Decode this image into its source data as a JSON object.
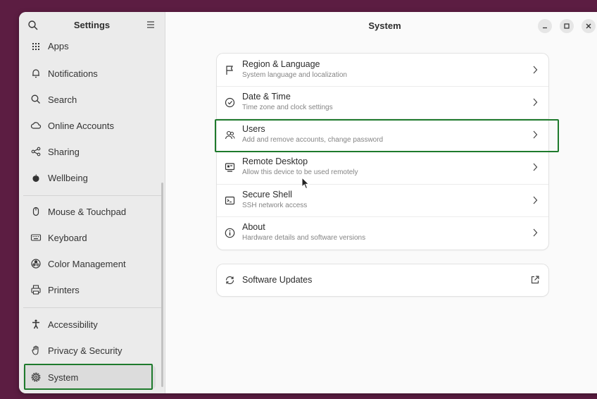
{
  "sidebar": {
    "title": "Settings",
    "items": [
      {
        "label": "Apps",
        "icon": "apps-grid-icon"
      },
      {
        "label": "Notifications",
        "icon": "bell-icon"
      },
      {
        "label": "Search",
        "icon": "search-icon"
      },
      {
        "label": "Online Accounts",
        "icon": "cloud-icon"
      },
      {
        "label": "Sharing",
        "icon": "share-icon"
      },
      {
        "label": "Wellbeing",
        "icon": "wellbeing-icon"
      },
      {
        "label": "Mouse & Touchpad",
        "icon": "mouse-icon"
      },
      {
        "label": "Keyboard",
        "icon": "keyboard-icon"
      },
      {
        "label": "Color Management",
        "icon": "palette-icon"
      },
      {
        "label": "Printers",
        "icon": "printer-icon"
      },
      {
        "label": "Accessibility",
        "icon": "accessibility-icon"
      },
      {
        "label": "Privacy & Security",
        "icon": "hand-icon"
      },
      {
        "label": "System",
        "icon": "gear-icon",
        "selected": true
      }
    ]
  },
  "main": {
    "title": "System",
    "rows": [
      {
        "title": "Region & Language",
        "subtitle": "System language and localization",
        "icon": "flag-icon"
      },
      {
        "title": "Date & Time",
        "subtitle": "Time zone and clock settings",
        "icon": "clock-icon"
      },
      {
        "title": "Users",
        "subtitle": "Add and remove accounts, change password",
        "icon": "users-icon"
      },
      {
        "title": "Remote Desktop",
        "subtitle": "Allow this device to be used remotely",
        "icon": "remote-desktop-icon"
      },
      {
        "title": "Secure Shell",
        "subtitle": "SSH network access",
        "icon": "terminal-icon"
      },
      {
        "title": "About",
        "subtitle": "Hardware details and software versions",
        "icon": "info-icon"
      }
    ],
    "updates": {
      "title": "Software Updates",
      "icon": "refresh-icon"
    }
  },
  "colors": {
    "highlight": "#1e7a2c",
    "background": "#5c1d42"
  }
}
